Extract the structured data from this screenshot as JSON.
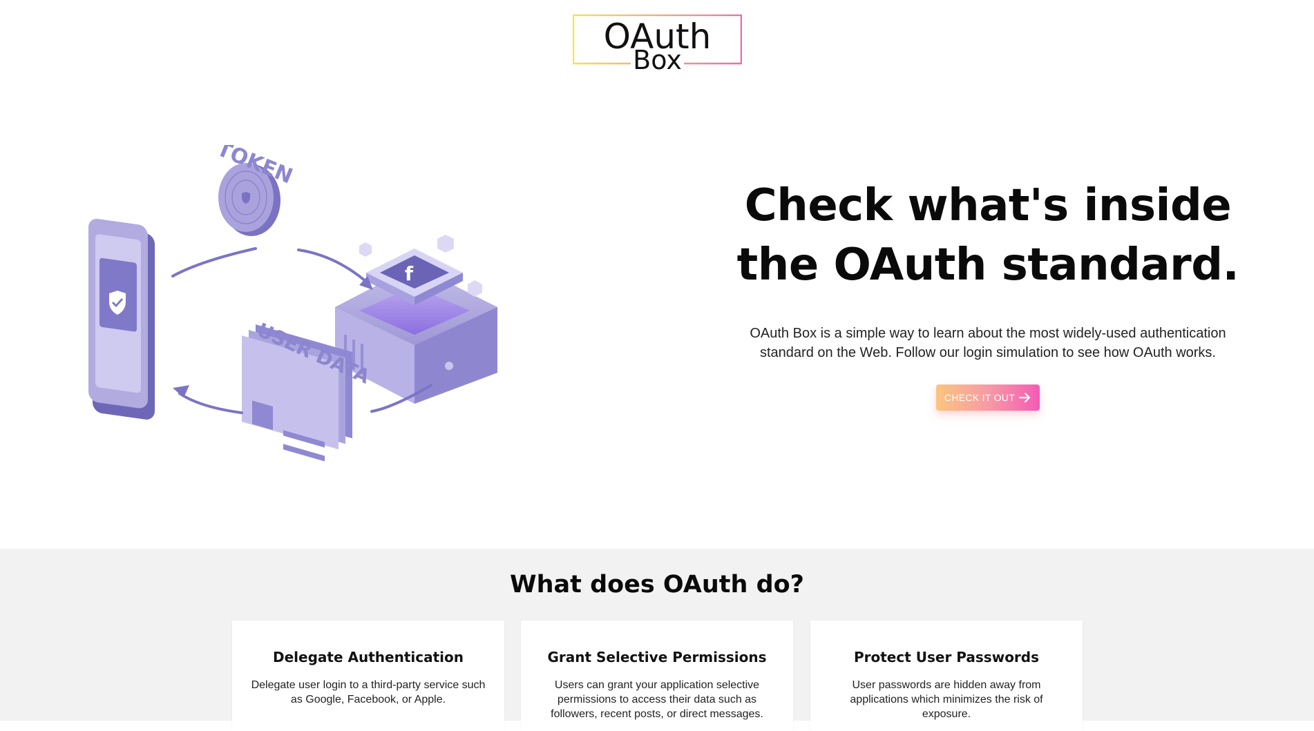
{
  "logo": {
    "main": "OAuth",
    "sub": "Box"
  },
  "hero": {
    "title": "Check what's inside the OAuth standard.",
    "description": "OAuth Box is a simple way to learn about the most widely-used authentication standard on the Web. Follow our login simulation to see how OAuth works.",
    "cta_label": "CHECK IT OUT",
    "illustration": {
      "token_label": "TOKEN",
      "user_data_label": "USER DATA",
      "service_letter": "f"
    }
  },
  "features": {
    "title": "What does OAuth do?",
    "cards": [
      {
        "title": "Delegate Authentication",
        "text": "Delegate user login to a third-party service such as Google, Facebook, or Apple."
      },
      {
        "title": "Grant Selective Permissions",
        "text": "Users can grant your application selective permissions to access their data such as followers, recent posts, or direct messages."
      },
      {
        "title": "Protect User Passwords",
        "text": "User passwords are hidden away from applications which minimizes the risk of exposure."
      }
    ]
  },
  "colors": {
    "illustration_purple": "#7b74c6",
    "illustration_light": "#c9c5ea",
    "logo_gradient_start": "#f7e24a",
    "logo_gradient_end": "#f06aa9",
    "cta_gradient_start": "#fbc57f",
    "cta_gradient_end": "#f45bb5",
    "features_background": "#f2f2f2"
  }
}
